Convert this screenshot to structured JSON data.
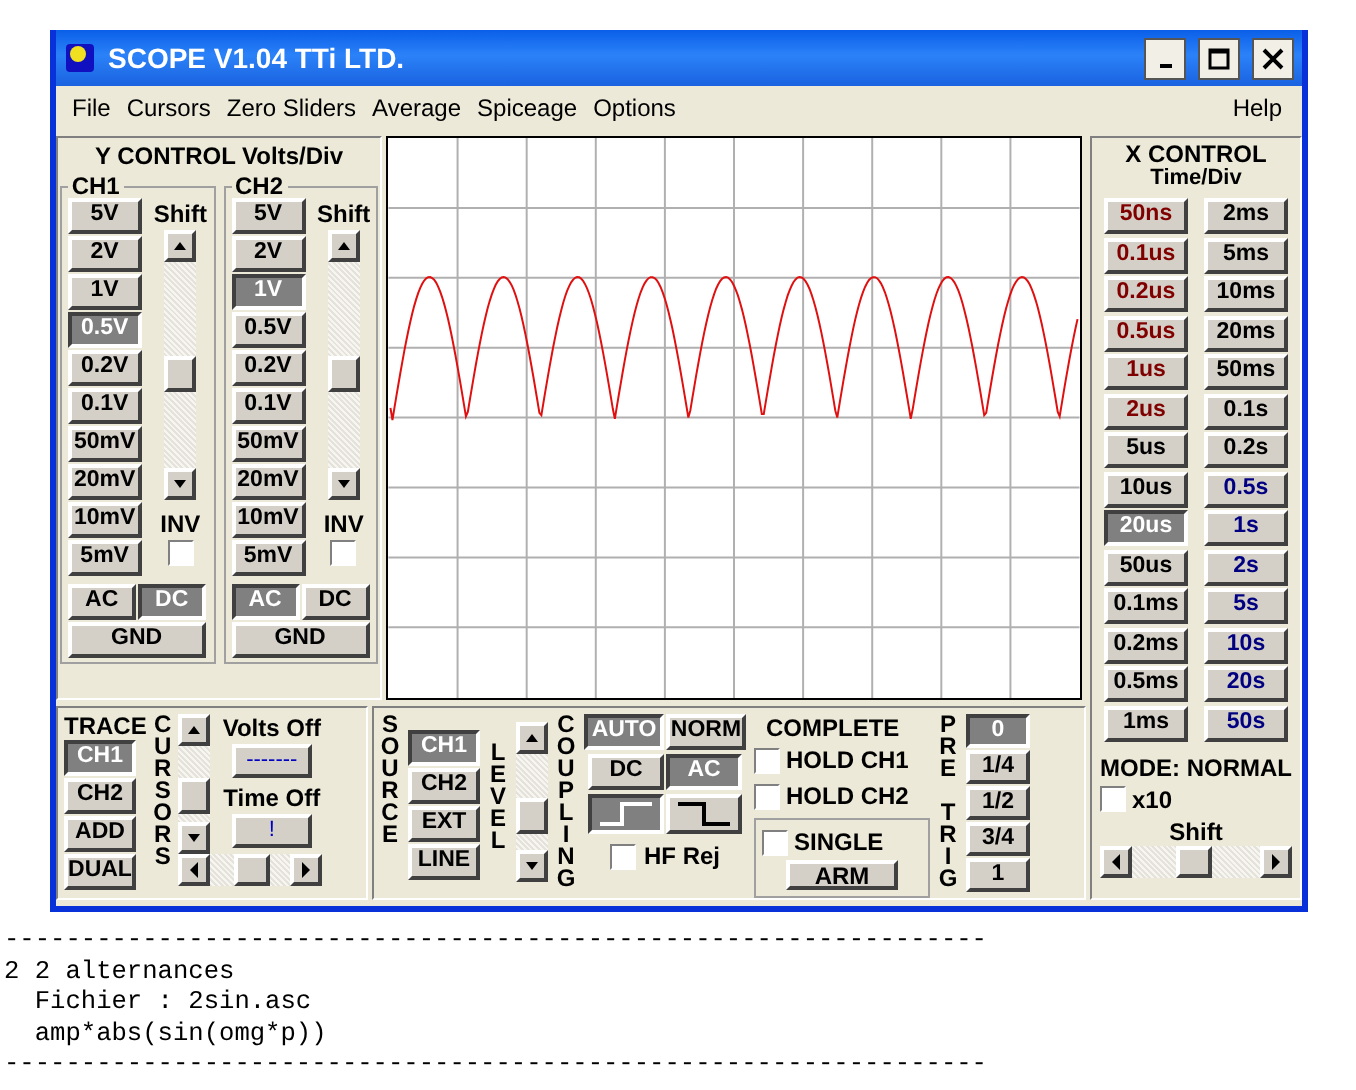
{
  "window": {
    "title": "SCOPE V1.04 TTi LTD."
  },
  "menu": [
    {
      "label": "File"
    },
    {
      "label": "Cursors"
    },
    {
      "label": "Zero Sliders"
    },
    {
      "label": "Average"
    },
    {
      "label": "Spiceage"
    },
    {
      "label": "Options"
    }
  ],
  "help_menu": {
    "label": "Help"
  },
  "y_control": {
    "title": "Y CONTROL Volts/Div",
    "channels": [
      {
        "name": "CH1",
        "shift_label": "Shift",
        "inv_label": "INV",
        "inv_checked": false,
        "volts": [
          {
            "label": "5V",
            "selected": false
          },
          {
            "label": "2V",
            "selected": false
          },
          {
            "label": "1V",
            "selected": false
          },
          {
            "label": "0.5V",
            "selected": true
          },
          {
            "label": "0.2V",
            "selected": false
          },
          {
            "label": "0.1V",
            "selected": false
          },
          {
            "label": "50mV",
            "selected": false
          },
          {
            "label": "20mV",
            "selected": false
          },
          {
            "label": "10mV",
            "selected": false
          },
          {
            "label": "5mV",
            "selected": false
          }
        ],
        "coupling": [
          {
            "label": "AC",
            "selected": false
          },
          {
            "label": "DC",
            "selected": true
          }
        ],
        "gnd": {
          "label": "GND",
          "selected": false
        }
      },
      {
        "name": "CH2",
        "shift_label": "Shift",
        "inv_label": "INV",
        "inv_checked": false,
        "volts": [
          {
            "label": "5V",
            "selected": false
          },
          {
            "label": "2V",
            "selected": false
          },
          {
            "label": "1V",
            "selected": true
          },
          {
            "label": "0.5V",
            "selected": false
          },
          {
            "label": "0.2V",
            "selected": false
          },
          {
            "label": "0.1V",
            "selected": false
          },
          {
            "label": "50mV",
            "selected": false
          },
          {
            "label": "20mV",
            "selected": false
          },
          {
            "label": "10mV",
            "selected": false
          },
          {
            "label": "5mV",
            "selected": false
          }
        ],
        "coupling": [
          {
            "label": "AC",
            "selected": true
          },
          {
            "label": "DC",
            "selected": false
          }
        ],
        "gnd": {
          "label": "GND",
          "selected": false
        }
      }
    ]
  },
  "x_control": {
    "title": "X CONTROL",
    "subtitle": "Time/Div",
    "timebase": [
      {
        "label": "50ns",
        "selected": false,
        "color": "#800000"
      },
      {
        "label": "0.1us",
        "selected": false,
        "color": "#800000"
      },
      {
        "label": "0.2us",
        "selected": false,
        "color": "#800000"
      },
      {
        "label": "0.5us",
        "selected": false,
        "color": "#800000"
      },
      {
        "label": "1us",
        "selected": false,
        "color": "#800000"
      },
      {
        "label": "2us",
        "selected": false,
        "color": "#800000"
      },
      {
        "label": "5us",
        "selected": false,
        "color": "#000000"
      },
      {
        "label": "10us",
        "selected": false,
        "color": "#000000"
      },
      {
        "label": "20us",
        "selected": true,
        "color": "#ffffff"
      },
      {
        "label": "50us",
        "selected": false,
        "color": "#000000"
      },
      {
        "label": "0.1ms",
        "selected": false,
        "color": "#000000"
      },
      {
        "label": "0.2ms",
        "selected": false,
        "color": "#000000"
      },
      {
        "label": "0.5ms",
        "selected": false,
        "color": "#000000"
      },
      {
        "label": "1ms",
        "selected": false,
        "color": "#000000"
      },
      {
        "label": "2ms",
        "selected": false,
        "color": "#000000"
      },
      {
        "label": "5ms",
        "selected": false,
        "color": "#000000"
      },
      {
        "label": "10ms",
        "selected": false,
        "color": "#000000"
      },
      {
        "label": "20ms",
        "selected": false,
        "color": "#000000"
      },
      {
        "label": "50ms",
        "selected": false,
        "color": "#000000"
      },
      {
        "label": "0.1s",
        "selected": false,
        "color": "#000000"
      },
      {
        "label": "0.2s",
        "selected": false,
        "color": "#000000"
      },
      {
        "label": "0.5s",
        "selected": false,
        "color": "#000080"
      },
      {
        "label": "1s",
        "selected": false,
        "color": "#000080"
      },
      {
        "label": "2s",
        "selected": false,
        "color": "#000080"
      },
      {
        "label": "5s",
        "selected": false,
        "color": "#000080"
      },
      {
        "label": "10s",
        "selected": false,
        "color": "#000080"
      },
      {
        "label": "20s",
        "selected": false,
        "color": "#000080"
      },
      {
        "label": "50s",
        "selected": false,
        "color": "#000080"
      }
    ],
    "mode": "MODE: NORMAL",
    "x10": {
      "label": "x10",
      "checked": false
    },
    "shift_label": "Shift"
  },
  "trace": {
    "label": "TRACE",
    "buttons": [
      {
        "label": "CH1",
        "selected": true
      },
      {
        "label": "CH2",
        "selected": false
      },
      {
        "label": "ADD",
        "selected": false
      },
      {
        "label": "DUAL",
        "selected": false
      }
    ],
    "cursors_label": "CURSORS",
    "volts_off_label": "Volts Off",
    "volts_off_value": "-------",
    "time_off_label": "Time Off",
    "time_off_value": "!"
  },
  "trigger": {
    "source_label": "SOURCE",
    "sources": [
      {
        "label": "CH1",
        "selected": true
      },
      {
        "label": "CH2",
        "selected": false
      },
      {
        "label": "EXT",
        "selected": false
      },
      {
        "label": "LINE",
        "selected": false
      }
    ],
    "level_label": "LEVEL",
    "coupling_label": "COUPLING",
    "modes": [
      {
        "label": "AUTO",
        "selected": true
      },
      {
        "label": "NORM",
        "selected": false
      }
    ],
    "couplings": [
      {
        "label": "DC",
        "selected": false
      },
      {
        "label": "AC",
        "selected": true
      }
    ],
    "edges": [
      {
        "kind": "rising",
        "selected": true
      },
      {
        "kind": "falling",
        "selected": false
      }
    ],
    "hf_rej": {
      "label": "HF Rej",
      "checked": false
    },
    "complete_label": "COMPLETE",
    "holds": [
      {
        "label": "HOLD CH1",
        "checked": false
      },
      {
        "label": "HOLD CH2",
        "checked": false
      }
    ],
    "single": {
      "label": "SINGLE",
      "checked": false
    },
    "arm": {
      "label": "ARM"
    },
    "pretrig_label": "PRE TRIG",
    "pretrig": [
      {
        "label": "0",
        "selected": true
      },
      {
        "label": "1/4",
        "selected": false
      },
      {
        "label": "1/2",
        "selected": false
      },
      {
        "label": "3/4",
        "selected": false
      },
      {
        "label": "1",
        "selected": false
      }
    ]
  },
  "console": [
    "----------------------------------------------------------------",
    "2 2 alternances",
    "  Fichier : 2sin.asc",
    "  amp*abs(sin(omg*p))",
    "----------------------------------------------------------------"
  ]
}
